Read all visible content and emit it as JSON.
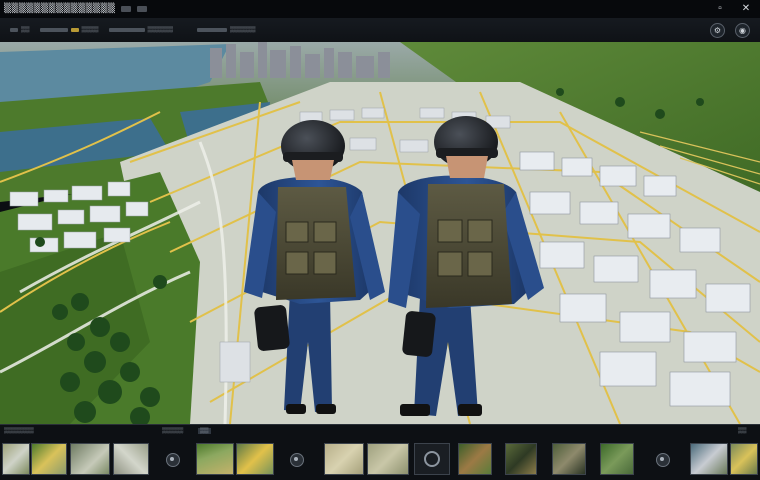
{
  "window": {
    "title": "▒▒▒▒▒▒▒▒▒▒▒▒▒▒▒",
    "minimize_icon": "minimize-icon",
    "close_icon": "close-icon"
  },
  "toolbar": {
    "items": [
      "▒▒",
      "▒▒▒▒",
      "▒▒▒▒▒▒",
      "▒▒▒▒▒▒",
      "▒▒▒▒"
    ],
    "right_icons": [
      "settings-icon",
      "camera-icon"
    ]
  },
  "filmstrip": {
    "left_label": "▒▒▒▒▒▒▒",
    "center_label": "▒▒▒▒▒",
    "center_badge": "▒▒",
    "right_label": "▒▒"
  },
  "colors": {
    "uniform": "#274a86",
    "road": "#e1c14a",
    "grass": "#4d7a2c",
    "water": "#3d6f8c",
    "building": "#e6eaee"
  },
  "scene": {
    "characters": [
      "soldier-left",
      "soldier-right"
    ],
    "background": "aerial-city-map"
  }
}
